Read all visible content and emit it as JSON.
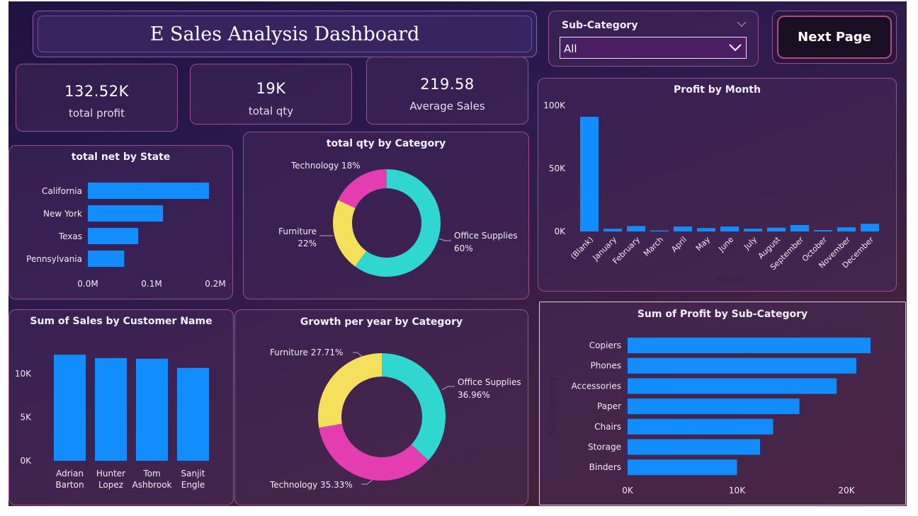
{
  "header": {
    "title": "E Sales Analysis Dashboard"
  },
  "slicer": {
    "label": "Sub-Category",
    "value": "All"
  },
  "next_button": {
    "label": "Next Page"
  },
  "kpis": [
    {
      "value": "132.52K",
      "label": "total profit"
    },
    {
      "value": "19K",
      "label": "total qty"
    },
    {
      "value": "219.58",
      "label": "Average Sales"
    }
  ],
  "colors": {
    "bar": "#118dff",
    "office_supplies": "#30d6d0",
    "furniture": "#f5e05b",
    "technology": "#e33db1",
    "card_border": "#9a4d8f"
  },
  "chart_data": [
    {
      "id": "state",
      "type": "bar",
      "orientation": "horizontal",
      "title": "total net by State",
      "categories": [
        "California",
        "New York",
        "Texas",
        "Pennsylvania"
      ],
      "values": [
        0.19,
        0.118,
        0.079,
        0.057
      ],
      "value_unit": "M",
      "ticks": [
        "0.0M",
        "0.1M",
        "0.2M"
      ],
      "xlim": [
        0,
        0.2
      ]
    },
    {
      "id": "qty_category",
      "type": "pie",
      "style": "donut",
      "title": "total qty by Category",
      "slices": [
        {
          "name": "Office Supplies",
          "pct": "60%",
          "value": 60
        },
        {
          "name": "Furniture",
          "pct": "22%",
          "value": 22
        },
        {
          "name": "Technology",
          "pct": "18%",
          "value": 18
        }
      ],
      "labels": [
        "Technology 18%",
        "Furniture",
        "22%",
        "Office Supplies",
        "60%"
      ]
    },
    {
      "id": "month",
      "type": "bar",
      "title": "Profit by Month",
      "xlabel": "Month",
      "categories": [
        "(Blank)",
        "January",
        "February",
        "March",
        "April",
        "May",
        "June",
        "July",
        "August",
        "September",
        "October",
        "November",
        "December"
      ],
      "values": [
        91000,
        2100,
        4300,
        800,
        3900,
        2700,
        3900,
        2200,
        3000,
        5100,
        1100,
        3300,
        6100
      ],
      "ticks": [
        "0K",
        "50K",
        "100K"
      ],
      "ylim": [
        0,
        100000
      ]
    },
    {
      "id": "customer",
      "type": "bar",
      "title": "Sum of Sales by Customer Name",
      "categories": [
        [
          "Adrian",
          "Barton"
        ],
        [
          "Hunter",
          "Lopez"
        ],
        [
          "Tom",
          "Ashbrook"
        ],
        [
          "Sanjit",
          "Engle"
        ]
      ],
      "values": [
        12180,
        11790,
        11720,
        10660
      ],
      "ticks": [
        "0K",
        "5K",
        "10K"
      ],
      "ylim": [
        0,
        14300
      ]
    },
    {
      "id": "growth",
      "type": "pie",
      "style": "donut",
      "title": "Growth per year by Category",
      "slices": [
        {
          "name": "Office Supplies",
          "pct": "36.96%",
          "value": 36.96
        },
        {
          "name": "Technology",
          "pct": "35.33%",
          "value": 35.33
        },
        {
          "name": "Furniture",
          "pct": "27.71%",
          "value": 27.71
        }
      ],
      "labels": [
        "Furniture 27.71%",
        "Office Supplies",
        "36.96%",
        "Technology 35.33%"
      ]
    },
    {
      "id": "subcat",
      "type": "bar",
      "orientation": "horizontal",
      "title": "Sum of Profit by Sub-Category",
      "ylabel": "Sub-Category",
      "categories": [
        "Copiers",
        "Phones",
        "Accessories",
        "Paper",
        "Chairs",
        "Storage",
        "Binders"
      ],
      "values": [
        22200,
        20900,
        19100,
        15700,
        13300,
        12100,
        10000
      ],
      "ticks": [
        "0K",
        "10K",
        "20K"
      ],
      "xlim": [
        0,
        20000
      ]
    }
  ]
}
